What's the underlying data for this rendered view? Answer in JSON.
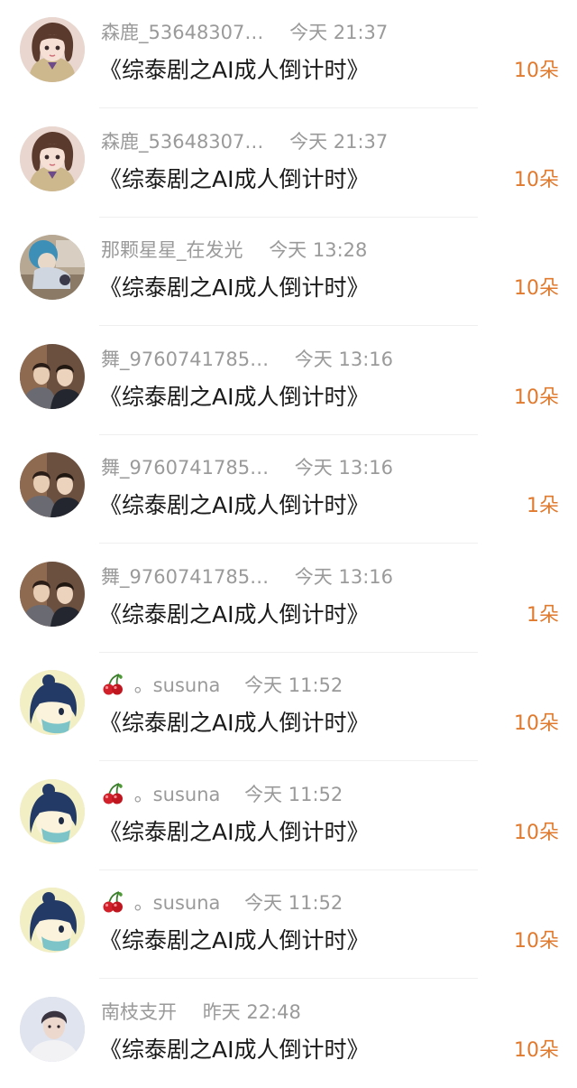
{
  "gifts": [
    {
      "name": "森鹿_53648307…",
      "time": "今天 21:37",
      "title": "《综泰剧之AI成人倒计时》",
      "amount": "10朵",
      "avatar": "girl-avatar",
      "cherry": false
    },
    {
      "name": "森鹿_53648307…",
      "time": "今天 21:37",
      "title": "《综泰剧之AI成人倒计时》",
      "amount": "10朵",
      "avatar": "girl-avatar",
      "cherry": false
    },
    {
      "name": "那颗星星_在发光",
      "time": "今天 13:28",
      "title": "《综泰剧之AI成人倒计时》",
      "amount": "10朵",
      "avatar": "photo-avatar",
      "cherry": false
    },
    {
      "name": "舞_9760741785…",
      "time": "今天 13:16",
      "title": "《综泰剧之AI成人倒计时》",
      "amount": "10朵",
      "avatar": "two-men-avatar",
      "cherry": false
    },
    {
      "name": "舞_9760741785…",
      "time": "今天 13:16",
      "title": "《综泰剧之AI成人倒计时》",
      "amount": "1朵",
      "avatar": "two-men-avatar",
      "cherry": false
    },
    {
      "name": "舞_9760741785…",
      "time": "今天 13:16",
      "title": "《综泰剧之AI成人倒计时》",
      "amount": "1朵",
      "avatar": "two-men-avatar",
      "cherry": false
    },
    {
      "name": "。susuna",
      "time": "今天 11:52",
      "title": "《综泰剧之AI成人倒计时》",
      "amount": "10朵",
      "avatar": "cartoon-mask-avatar",
      "cherry": true
    },
    {
      "name": "。susuna",
      "time": "今天 11:52",
      "title": "《综泰剧之AI成人倒计时》",
      "amount": "10朵",
      "avatar": "cartoon-mask-avatar",
      "cherry": true
    },
    {
      "name": "。susuna",
      "time": "今天 11:52",
      "title": "《综泰剧之AI成人倒计时》",
      "amount": "10朵",
      "avatar": "cartoon-mask-avatar",
      "cherry": true
    },
    {
      "name": "南枝支开",
      "time": "昨天 22:48",
      "title": "《综泰剧之AI成人倒计时》",
      "amount": "10朵",
      "avatar": "portrait-avatar",
      "cherry": false
    }
  ],
  "colors": {
    "meta_text": "#9a9a9a",
    "title_text": "#1a1a1a",
    "amount_accent": "#e07a2e",
    "divider": "#efefef"
  }
}
